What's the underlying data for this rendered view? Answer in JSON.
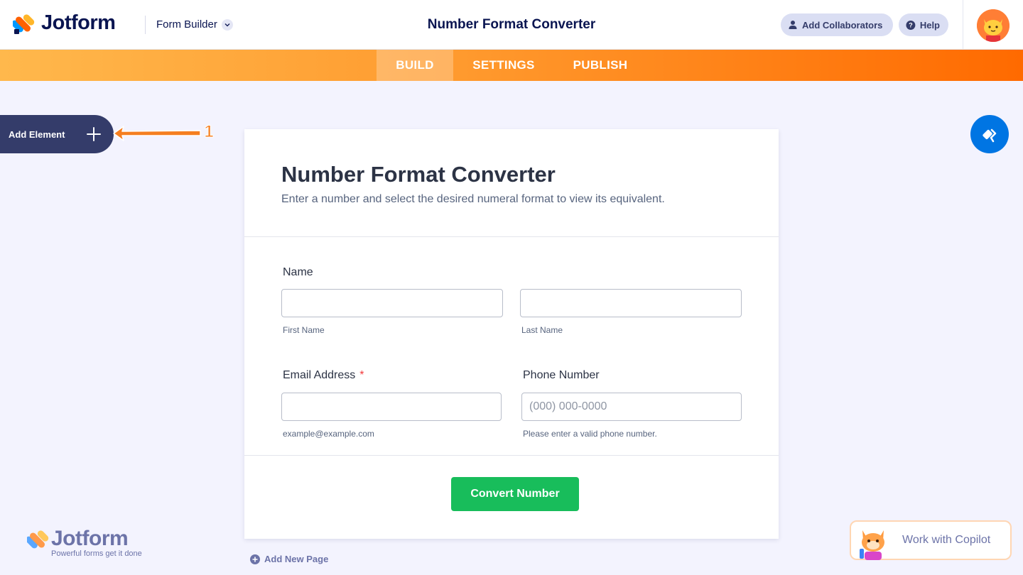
{
  "brand": {
    "name": "Jotform",
    "tagline": "Powerful forms get it done"
  },
  "header": {
    "mode_label": "Form Builder",
    "app_title": "Number Format Converter",
    "collaborators_label": "Add Collaborators",
    "help_label": "Help"
  },
  "nav": {
    "tabs": [
      "BUILD",
      "SETTINGS",
      "PUBLISH"
    ],
    "active": "BUILD"
  },
  "sidebar": {
    "add_element_label": "Add Element",
    "annotation_number": "1"
  },
  "form": {
    "title": "Number Format Converter",
    "subtitle": "Enter a number and select the desired numeral format to view its equivalent.",
    "name_label": "Name",
    "first_name_sublabel": "First Name",
    "last_name_sublabel": "Last Name",
    "email_label": "Email Address",
    "required_mark": "*",
    "email_sublabel": "example@example.com",
    "phone_label": "Phone Number",
    "phone_placeholder": "(000) 000-0000",
    "phone_sublabel": "Please enter a valid phone number.",
    "submit_label": "Convert Number"
  },
  "footer": {
    "add_page_label": "Add New Page",
    "copilot_label": "Work with Copilot"
  },
  "colors": {
    "navy": "#0a1551",
    "orange": "#ff6100",
    "submit_green": "#18bd5b",
    "paint_blue": "#0075e3"
  }
}
